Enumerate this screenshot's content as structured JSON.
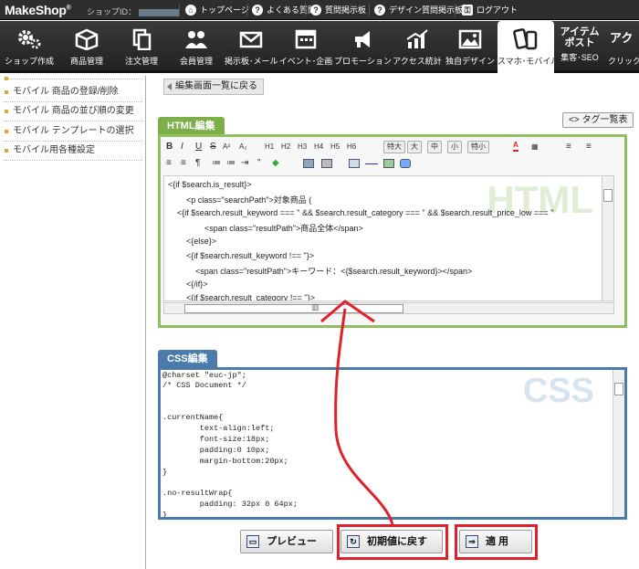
{
  "topbar": {
    "logo": "MakeShop",
    "shop_id_label": "ショップID：",
    "links": [
      {
        "label": "トップページ",
        "icon": "home-icon"
      },
      {
        "label": "よくある質問",
        "icon": "question-icon"
      },
      {
        "label": "質問掲示板",
        "icon": "question-icon"
      },
      {
        "label": "デザイン質問掲示板",
        "icon": "question-icon"
      },
      {
        "label": "ログアウト",
        "icon": "lock-icon"
      }
    ]
  },
  "nav": {
    "items": [
      {
        "label": "ショップ作成",
        "icon": "gears-icon"
      },
      {
        "label": "商品管理",
        "icon": "box-icon"
      },
      {
        "label": "注文管理",
        "icon": "documents-icon"
      },
      {
        "label": "会員管理",
        "icon": "users-icon"
      },
      {
        "label": "掲示板･メール",
        "icon": "envelope-icon"
      },
      {
        "label": "イベント･企画",
        "icon": "calendar-icon"
      },
      {
        "label": "プロモーション",
        "icon": "megaphone-icon"
      },
      {
        "label": "アクセス統計",
        "icon": "bar-chart-icon"
      },
      {
        "label": "独自デザイン",
        "icon": "picture-icon"
      },
      {
        "label": "スマホ･モバイル",
        "icon": "mobile-phones-icon",
        "active": true
      },
      {
        "label": "集客･SEO",
        "icon": "item-post-logo-icon",
        "logo_text": "アイテム\nポスト"
      },
      {
        "label": "クリック",
        "icon": "click-logo-icon",
        "logo_text": "アク"
      }
    ]
  },
  "sidebar": {
    "items": [
      {
        "label": "モバイル 商品の登録/削除"
      },
      {
        "label": "モバイル 商品の並び順の変更"
      },
      {
        "label": "モバイル テンプレートの選択"
      },
      {
        "label": "モバイル用各種設定"
      }
    ]
  },
  "main": {
    "back_button": "編集画面一覧に戻る",
    "html_tab": "HTML編集",
    "css_tab": "CSS編集",
    "tag_list_button": "<> タグ一覧表",
    "html_watermark": "HTML",
    "css_watermark": "CSS",
    "toolbar": {
      "row1": [
        "B",
        "I",
        "U",
        "S",
        "A²",
        "A₂",
        "H1",
        "H2",
        "H3",
        "H4",
        "H5",
        "H6",
        "特大",
        "大",
        "中",
        "小",
        "特小",
        "A",
        "▦"
      ],
      "row2": [
        "≡",
        "≡",
        "¶",
        "≔",
        "≔",
        "\"",
        "◆"
      ]
    },
    "html_lines": [
      "<{if $search.is_result}>",
      "        <p class=\"searchPath\">対象商品 (",
      "    <{if $search.result_keyword === '' && $search.result_category === '' && $search.result_price_low === ''",
      "                <span class=\"resultPath\">商品全体</span>",
      "        <{else}>",
      "        <{if $search.result_keyword !== ''}>",
      "            <span class=\"resultPath\">キーワード：<{$search.result_keyword}></span>",
      "        <{/if}>",
      "        <{if $search.result_category !== ''}>"
    ],
    "css_lines": [
      "@charset \"euc-jp\";",
      "/* CSS Document */",
      "",
      "",
      ".currentName{",
      "        text-align:left;",
      "        font-size:18px;",
      "        padding:0 10px;",
      "        margin-bottom:20px;",
      "}",
      "",
      ".no-resultWrap{",
      "        padding: 32px 0 64px;",
      "}"
    ],
    "buttons": {
      "preview": "プレビュー",
      "reset": "初期値に戻す",
      "apply": "適 用"
    }
  },
  "colors": {
    "html_accent": "#7cae4a",
    "css_accent": "#4a7bab",
    "highlight": "#e0202a"
  }
}
